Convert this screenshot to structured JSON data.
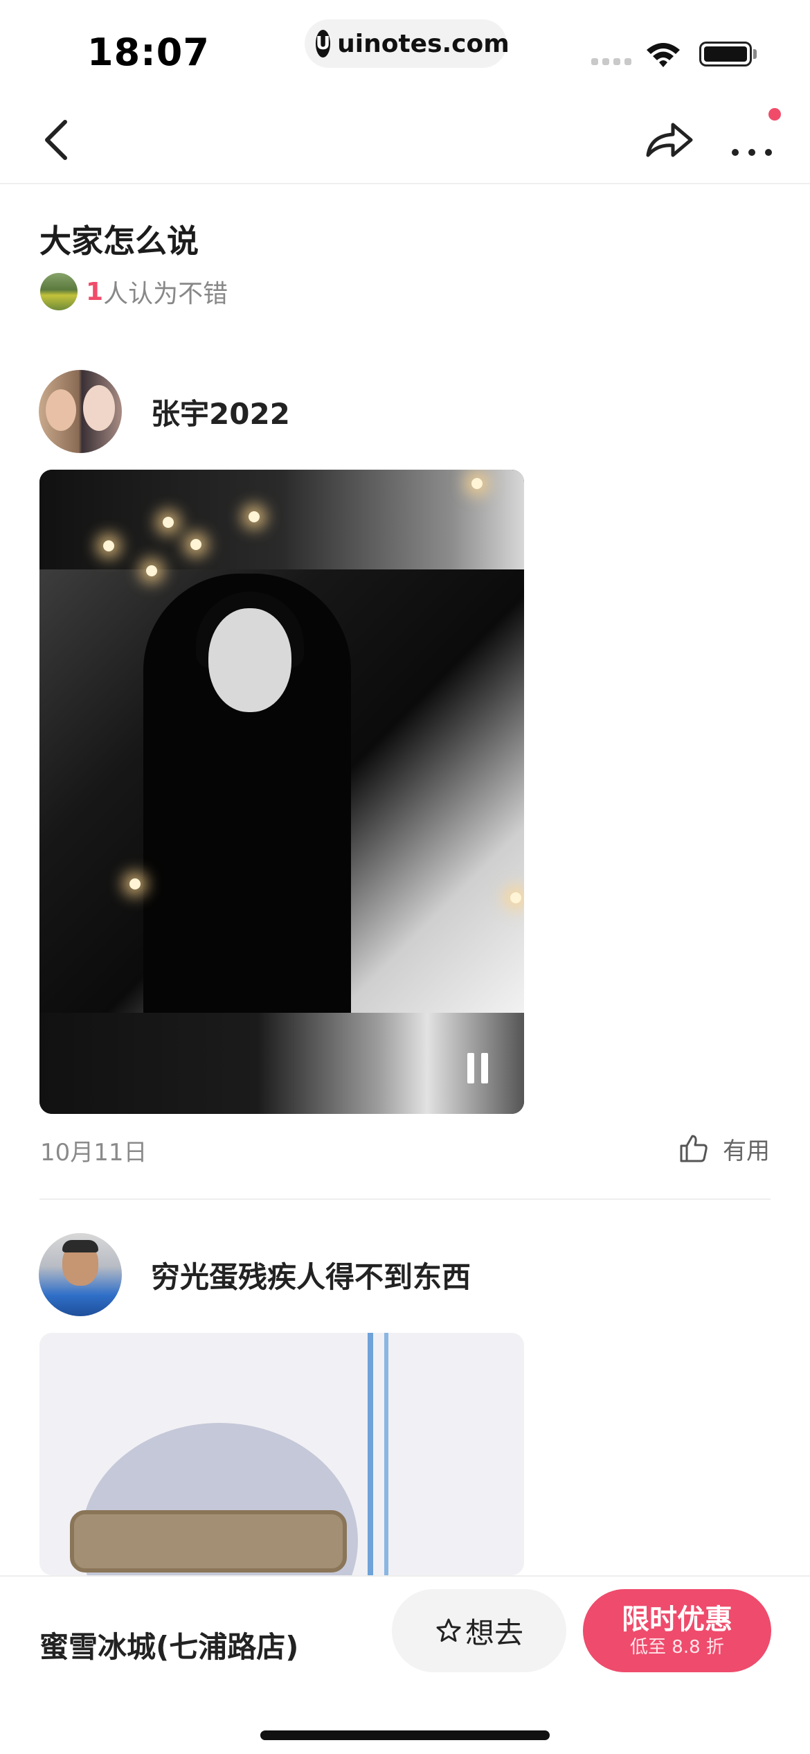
{
  "status_bar": {
    "time": "18:07",
    "url": "uinotes.com",
    "url_logo": "U"
  },
  "nav": {
    "back_icon": "chevron-left-icon",
    "share_icon": "share-arrow-icon",
    "more_icon": "more-dots-icon",
    "has_notification_dot": true
  },
  "section": {
    "title": "大家怎么说",
    "summary_count": "1",
    "summary_text": "人认为不错"
  },
  "reviews": [
    {
      "username": "张宇2022",
      "media_type": "video",
      "control_icon": "pause-icon",
      "date": "10月11日",
      "useful_label": "有用"
    },
    {
      "username": "穷光蛋残疾人得不到东西",
      "media_type": "photo"
    }
  ],
  "bottom_bar": {
    "store_name": "蜜雪冰城(七浦路店)",
    "want_label": "想去",
    "deal_title": "限时优惠",
    "deal_subtitle": "低至 8.8 折"
  },
  "colors": {
    "accent": "#ef4b6c",
    "text_primary": "#222222",
    "text_secondary": "#8a8a8a"
  }
}
